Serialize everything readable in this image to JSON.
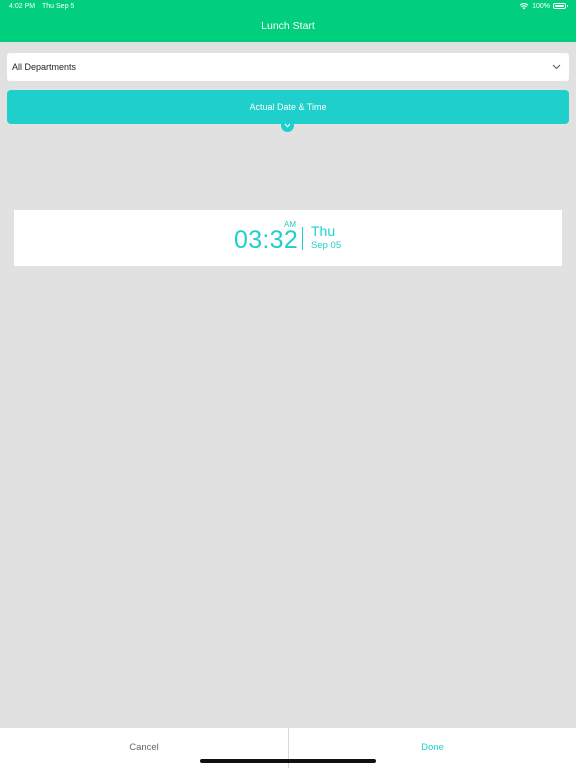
{
  "status_bar": {
    "time": "4:02 PM",
    "date": "Thu Sep 5",
    "battery": "100%"
  },
  "nav": {
    "title": "Lunch Start"
  },
  "department_select": {
    "value": "All Departments"
  },
  "date_bar": {
    "label": "Actual Date & Time"
  },
  "picker": {
    "time": "03:32",
    "ampm": "AM",
    "weekday": "Thu",
    "date": "Sep 05"
  },
  "actions": {
    "cancel": "Cancel",
    "done": "Done"
  },
  "colors": {
    "header": "#01cf7e",
    "accent": "#1fcfcb",
    "background": "#e1e1e1"
  },
  "icons": [
    "wifi-icon",
    "battery-icon",
    "chevron-down-icon"
  ]
}
